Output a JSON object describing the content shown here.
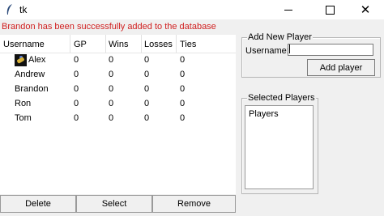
{
  "window": {
    "title": "tk"
  },
  "status": {
    "message": "Brandon has been successfully added to the database",
    "color": "#d02020"
  },
  "table": {
    "columns": [
      "Username",
      "GP",
      "Wins",
      "Losses",
      "Ties"
    ],
    "rows": [
      [
        "Alex",
        "0",
        "0",
        "0",
        "0"
      ],
      [
        "Andrew",
        "0",
        "0",
        "0",
        "0"
      ],
      [
        "Brandon",
        "0",
        "0",
        "0",
        "0"
      ],
      [
        "Ron",
        "0",
        "0",
        "0",
        "0"
      ],
      [
        "Tom",
        "0",
        "0",
        "0",
        "0"
      ]
    ]
  },
  "buttons": {
    "delete": "Delete",
    "select": "Select",
    "remove": "Remove"
  },
  "add_player": {
    "title": "Add New Player",
    "username_label": "Username:",
    "username_value": "",
    "button": "Add player"
  },
  "selected_players": {
    "title": "Selected Players",
    "items": [
      "Players"
    ]
  }
}
